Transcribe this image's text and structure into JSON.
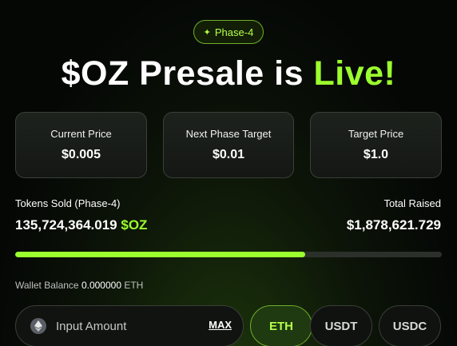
{
  "phase_badge": {
    "icon": "sparkle-icon",
    "label": "Phase-4"
  },
  "headline": {
    "prefix": "$OZ Presale is ",
    "highlight": "Live!"
  },
  "cards": [
    {
      "label": "Current Price",
      "value": "$0.005"
    },
    {
      "label": "Next Phase Target",
      "value": "$0.01"
    },
    {
      "label": "Target Price",
      "value": "$1.0"
    }
  ],
  "tokens_sold": {
    "label": "Tokens Sold (Phase-4)",
    "amount": "135,724,364.019",
    "unit": "$OZ"
  },
  "total_raised": {
    "label": "Total Raised",
    "amount": "$1,878,621.729"
  },
  "progress": {
    "fraction": 0.68
  },
  "wallet": {
    "label": "Wallet Balance",
    "amount": "0.000000",
    "unit": "ETH"
  },
  "input": {
    "placeholder": "Input Amount",
    "icon": "ethereum-icon",
    "max_label": "MAX"
  },
  "currency_options": [
    {
      "label": "ETH",
      "active": true
    },
    {
      "label": "USDT",
      "active": false
    },
    {
      "label": "USDC",
      "active": false
    }
  ],
  "colors": {
    "accent": "#9cff2e",
    "card_border": "#3a3f38",
    "background": "#050705"
  }
}
